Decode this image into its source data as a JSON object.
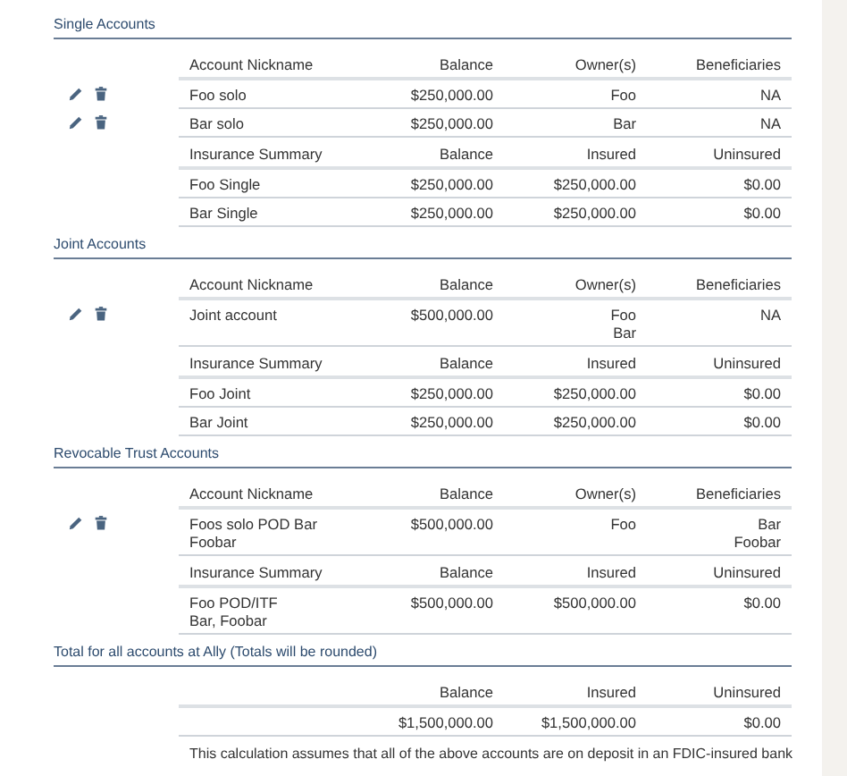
{
  "sections": [
    {
      "title": "Single Accounts",
      "accounts": {
        "columns": [
          "Account Nickname",
          "Balance",
          "Owner(s)",
          "Beneficiaries"
        ],
        "rows": [
          {
            "cells": [
              [
                "Foo solo"
              ],
              [
                "$250,000.00"
              ],
              [
                "Foo"
              ],
              [
                "NA"
              ]
            ]
          },
          {
            "cells": [
              [
                "Bar solo"
              ],
              [
                "$250,000.00"
              ],
              [
                "Bar"
              ],
              [
                "NA"
              ]
            ]
          }
        ]
      },
      "insurance": {
        "columns": [
          "Insurance Summary",
          "Balance",
          "Insured",
          "Uninsured"
        ],
        "rows": [
          {
            "cells": [
              [
                "Foo Single"
              ],
              [
                "$250,000.00"
              ],
              [
                "$250,000.00"
              ],
              [
                "$0.00"
              ]
            ]
          },
          {
            "cells": [
              [
                "Bar Single"
              ],
              [
                "$250,000.00"
              ],
              [
                "$250,000.00"
              ],
              [
                "$0.00"
              ]
            ]
          }
        ]
      }
    },
    {
      "title": "Joint Accounts",
      "accounts": {
        "columns": [
          "Account Nickname",
          "Balance",
          "Owner(s)",
          "Beneficiaries"
        ],
        "rows": [
          {
            "cells": [
              [
                "Joint account"
              ],
              [
                "$500,000.00"
              ],
              [
                "Foo",
                "Bar"
              ],
              [
                "NA"
              ]
            ]
          }
        ]
      },
      "insurance": {
        "columns": [
          "Insurance Summary",
          "Balance",
          "Insured",
          "Uninsured"
        ],
        "rows": [
          {
            "cells": [
              [
                "Foo Joint"
              ],
              [
                "$250,000.00"
              ],
              [
                "$250,000.00"
              ],
              [
                "$0.00"
              ]
            ]
          },
          {
            "cells": [
              [
                "Bar Joint"
              ],
              [
                "$250,000.00"
              ],
              [
                "$250,000.00"
              ],
              [
                "$0.00"
              ]
            ]
          }
        ]
      }
    },
    {
      "title": "Revocable Trust Accounts",
      "accounts": {
        "columns": [
          "Account Nickname",
          "Balance",
          "Owner(s)",
          "Beneficiaries"
        ],
        "rows": [
          {
            "cells": [
              [
                "Foos solo POD Bar",
                "Foobar"
              ],
              [
                "$500,000.00"
              ],
              [
                "Foo"
              ],
              [
                "Bar",
                "Foobar"
              ]
            ]
          }
        ]
      },
      "insurance": {
        "columns": [
          "Insurance Summary",
          "Balance",
          "Insured",
          "Uninsured"
        ],
        "rows": [
          {
            "cells": [
              [
                "Foo POD/ITF",
                "Bar, Foobar"
              ],
              [
                "$500,000.00"
              ],
              [
                "$500,000.00"
              ],
              [
                "$0.00"
              ]
            ]
          }
        ]
      }
    }
  ],
  "total": {
    "title": "Total for all accounts at Ally (Totals will be rounded)",
    "columns": [
      "Balance",
      "Insured",
      "Uninsured"
    ],
    "row": [
      "$1,500,000.00",
      "$1,500,000.00",
      "$0.00"
    ],
    "note": "This calculation assumes that all of the above accounts are on deposit in an FDIC-insured bank"
  }
}
